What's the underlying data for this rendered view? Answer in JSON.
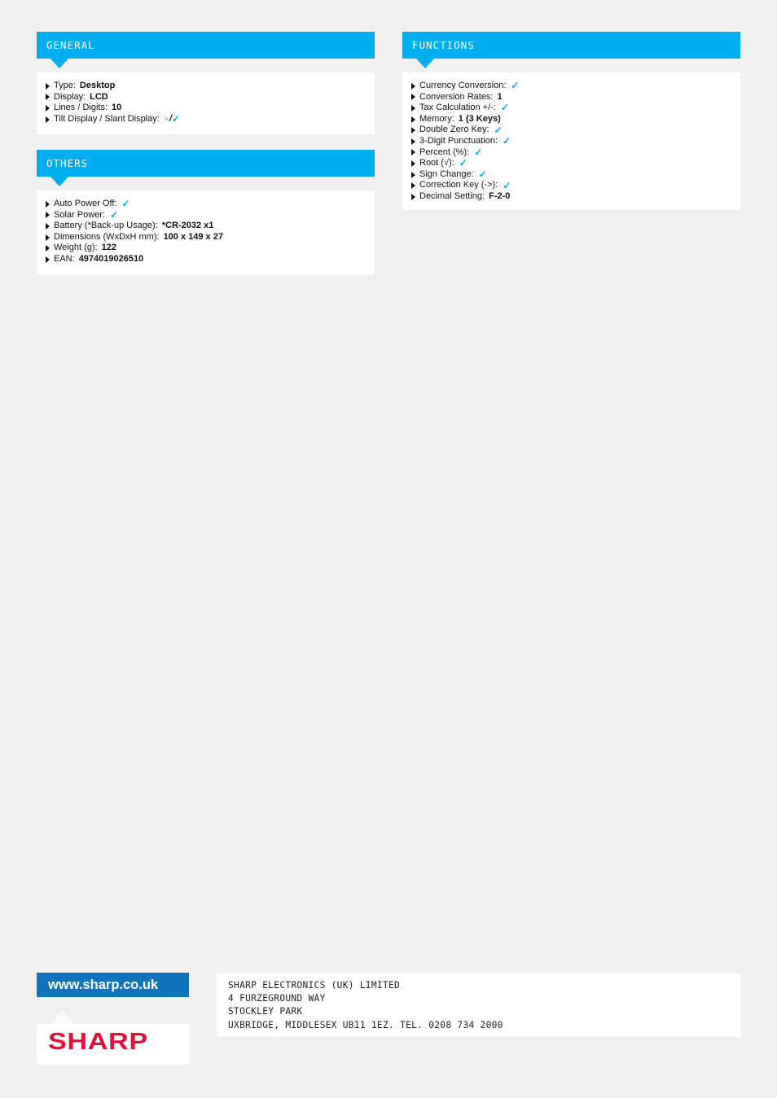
{
  "sections": {
    "general": {
      "title": "GENERAL",
      "rows": [
        {
          "label": "Type:",
          "value": "Desktop"
        },
        {
          "label": "Display:",
          "value": "LCD"
        },
        {
          "label": "Lines / Digits:",
          "value": "10"
        },
        {
          "label": "Tilt Display / Slant Display:",
          "cross": "×",
          "slash": "/",
          "check": "✓"
        }
      ]
    },
    "others": {
      "title": "OTHERS",
      "rows": [
        {
          "label": "Auto Power Off:",
          "check": "✓"
        },
        {
          "label": "Solar Power:",
          "check": "✓"
        },
        {
          "label": "Battery (*Back-up Usage):",
          "value": "*CR-2032 x1"
        },
        {
          "label": "Dimensions (WxDxH mm):",
          "value": "100 x 149 x 27"
        },
        {
          "label": "Weight (g):",
          "value": "122"
        },
        {
          "label": "EAN:",
          "value": "4974019026510"
        }
      ]
    },
    "functions": {
      "title": "FUNCTIONS",
      "rows": [
        {
          "label": "Currency Conversion:",
          "check": "✓"
        },
        {
          "label": "Conversion Rates:",
          "value": "1"
        },
        {
          "label": "Tax Calculation +/-:",
          "check": "✓"
        },
        {
          "label": "Memory:",
          "value": "1 (3 Keys)"
        },
        {
          "label": "Double Zero Key:",
          "check": "✓"
        },
        {
          "label": "3-Digit Punctuation:",
          "check": "✓"
        },
        {
          "label": "Percent (%):",
          "check": "✓"
        },
        {
          "label": "Root (√):",
          "check": "✓"
        },
        {
          "label": "Sign Change:",
          "check": "✓"
        },
        {
          "label": "Correction Key (->):",
          "check": "✓"
        },
        {
          "label": "Decimal Setting:",
          "value": "F-2-0"
        }
      ]
    }
  },
  "footer": {
    "url": "www.sharp.co.uk",
    "logo": "SHARP",
    "address_lines": [
      "SHARP ELECTRONICS (UK) LIMITED",
      "4 FURZEGROUND WAY",
      "STOCKLEY PARK",
      "UXBRIDGE, MIDDLESEX UB11 1EZ. TEL. 0208 734 2000"
    ]
  },
  "colors": {
    "accent": "#00adef",
    "url_bar": "#0f73b9",
    "logo_red": "#e3103a",
    "background": "#f0f0f0"
  }
}
